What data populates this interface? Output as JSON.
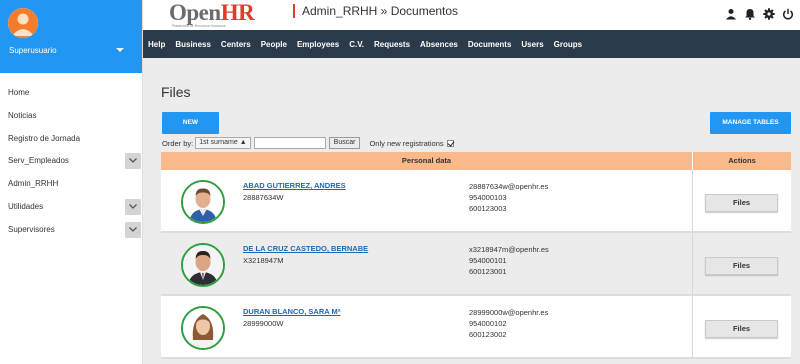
{
  "sidebar": {
    "user": "Superusuario",
    "items": [
      {
        "label": "Home"
      },
      {
        "label": "Noticias"
      },
      {
        "label": "Registro de Jornada"
      },
      {
        "label": "Serv_Empleados"
      },
      {
        "label": "Admin_RRHH"
      },
      {
        "label": "Utilidades"
      },
      {
        "label": "Supervisores"
      }
    ]
  },
  "header": {
    "logo_open": "Open",
    "logo_hr": "HR",
    "logo_tagline": "Plataforma de Recursos Humanos",
    "title": "Admin_RRHH » Documentos",
    "icons": [
      "user-icon",
      "bell-icon",
      "gear-icon",
      "power-icon"
    ]
  },
  "nav": [
    "Help",
    "Business",
    "Centers",
    "People",
    "Employees",
    "C.V.",
    "Requests",
    "Absences",
    "Documents",
    "Users",
    "Groups"
  ],
  "main": {
    "title": "Files",
    "new_button": "NEW",
    "manage_button": "MANAGE TABLES",
    "order_label": "Order by:",
    "order_value": "1st surname ▲",
    "search_button": "Buscar",
    "only_new_label": "Only new registrations",
    "only_new_checked": true,
    "col_personal": "Personal data",
    "col_actions": "Actions",
    "rows": [
      {
        "name": "ABAD GUTIERREZ, ANDRES",
        "id": "28887634W",
        "email": "28887634w@openhr.es",
        "phone1": "954000103",
        "phone2": "600123003",
        "action": "Files"
      },
      {
        "name": "DE LA CRUZ CASTEDO, BERNABE",
        "id": "X3218947M",
        "email": "x3218947m@openhr.es",
        "phone1": "954000101",
        "phone2": "600123001",
        "action": "Files"
      },
      {
        "name": "DURAN BLANCO, SARA Mª",
        "id": "28999000W",
        "email": "28999000w@openhr.es",
        "phone1": "954000102",
        "phone2": "600123002",
        "action": "Files"
      }
    ]
  },
  "colors": {
    "sidebar_header": "#2196f3",
    "navbar": "#2b3a4a",
    "table_header": "#f9b98a",
    "link": "#1a69b8",
    "logo_accent": "#e43a2e",
    "photo_border": "#2e9e3c"
  }
}
